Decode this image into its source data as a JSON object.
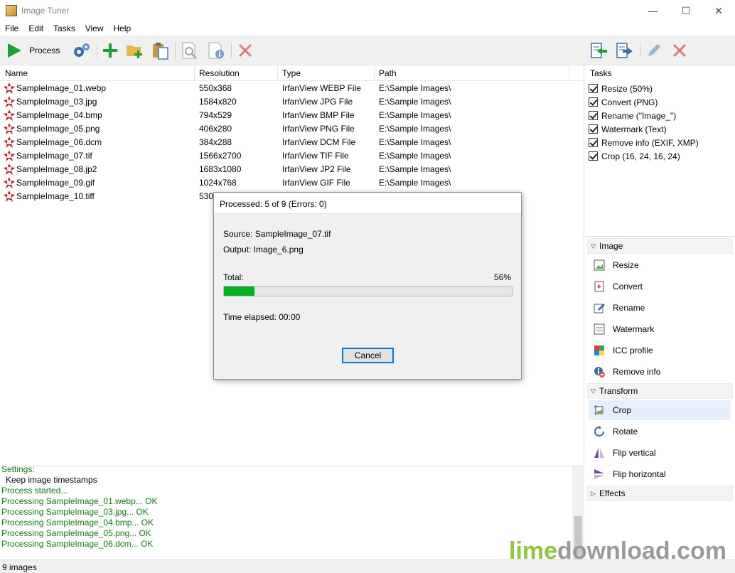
{
  "window": {
    "title": "Image Tuner",
    "minimize": "—",
    "maximize": "☐",
    "close": "✕"
  },
  "menu": [
    "File",
    "Edit",
    "Tasks",
    "View",
    "Help"
  ],
  "toolbar": {
    "process_label": "Process"
  },
  "filelist": {
    "columns": [
      "Name",
      "Resolution",
      "Type",
      "Path"
    ],
    "rows": [
      {
        "name": "SampleImage_01.webp",
        "resolution": "550x368",
        "type": "IrfanView WEBP File",
        "path": "E:\\Sample Images\\"
      },
      {
        "name": "SampleImage_03.jpg",
        "resolution": "1584x820",
        "type": "IrfanView JPG File",
        "path": "E:\\Sample Images\\"
      },
      {
        "name": "SampleImage_04.bmp",
        "resolution": "794x529",
        "type": "IrfanView BMP File",
        "path": "E:\\Sample Images\\"
      },
      {
        "name": "SampleImage_05.png",
        "resolution": "406x280",
        "type": "IrfanView PNG File",
        "path": "E:\\Sample Images\\"
      },
      {
        "name": "SampleImage_06.dcm",
        "resolution": "384x288",
        "type": "IrfanView DCM File",
        "path": "E:\\Sample Images\\"
      },
      {
        "name": "SampleImage_07.tif",
        "resolution": "1566x2700",
        "type": "IrfanView TIF File",
        "path": "E:\\Sample Images\\"
      },
      {
        "name": "SampleImage_08.jp2",
        "resolution": "1683x1080",
        "type": "IrfanView JP2 File",
        "path": "E:\\Sample Images\\"
      },
      {
        "name": "SampleImage_09.gif",
        "resolution": "1024x768",
        "type": "IrfanView GIF File",
        "path": "E:\\Sample Images\\"
      },
      {
        "name": "SampleImage_10.tiff",
        "resolution": "530x",
        "type": "",
        "path": ""
      }
    ]
  },
  "tasks": {
    "header": "Tasks",
    "items": [
      "Resize (50%)",
      "Convert (PNG)",
      "Rename (\"Image_\")",
      "Watermark (Text)",
      "Remove info (EXIF, XMP)",
      "Crop (16, 24, 16, 24)"
    ]
  },
  "actions": {
    "image_group": "Image",
    "image_items": [
      "Resize",
      "Convert",
      "Rename",
      "Watermark",
      "ICC profile",
      "Remove info"
    ],
    "transform_group": "Transform",
    "transform_items": [
      "Crop",
      "Rotate",
      "Flip vertical",
      "Flip horizontal"
    ],
    "effects_group": "Effects"
  },
  "log": {
    "lines": [
      {
        "text": "Settings:",
        "style": "green"
      },
      {
        "text": "  Keep image timestamps",
        "style": "black"
      },
      {
        "text": "Process started...",
        "style": "green"
      },
      {
        "text": "Processing SampleImage_01.webp... OK",
        "style": "green"
      },
      {
        "text": "Processing SampleImage_03.jpg... OK",
        "style": "green"
      },
      {
        "text": "Processing SampleImage_04.bmp... OK",
        "style": "green"
      },
      {
        "text": "Processing SampleImage_05.png... OK",
        "style": "green"
      },
      {
        "text": "Processing SampleImage_06.dcm... OK",
        "style": "green"
      }
    ]
  },
  "status": {
    "text": "9 images"
  },
  "dialog": {
    "title": "Processed: 5 of 9 (Errors: 0)",
    "source": "Source: SampleImage_07.tif",
    "output": "Output: Image_6.png",
    "total_label": "Total:",
    "percent": "56%",
    "progress": 0.105,
    "elapsed": "Time elapsed: 00:00",
    "cancel_label": "Cancel"
  },
  "watermark": {
    "part1": "lime",
    "part2": "download",
    "part3": ".com"
  },
  "colors": {
    "toolbar_bg": "#f0f0f0",
    "log_green": "#108010",
    "progress_green": "#06b025",
    "accent": "#0078d7",
    "watermark_lime": "#8dc63f",
    "watermark_gray": "#9a9a9a"
  }
}
